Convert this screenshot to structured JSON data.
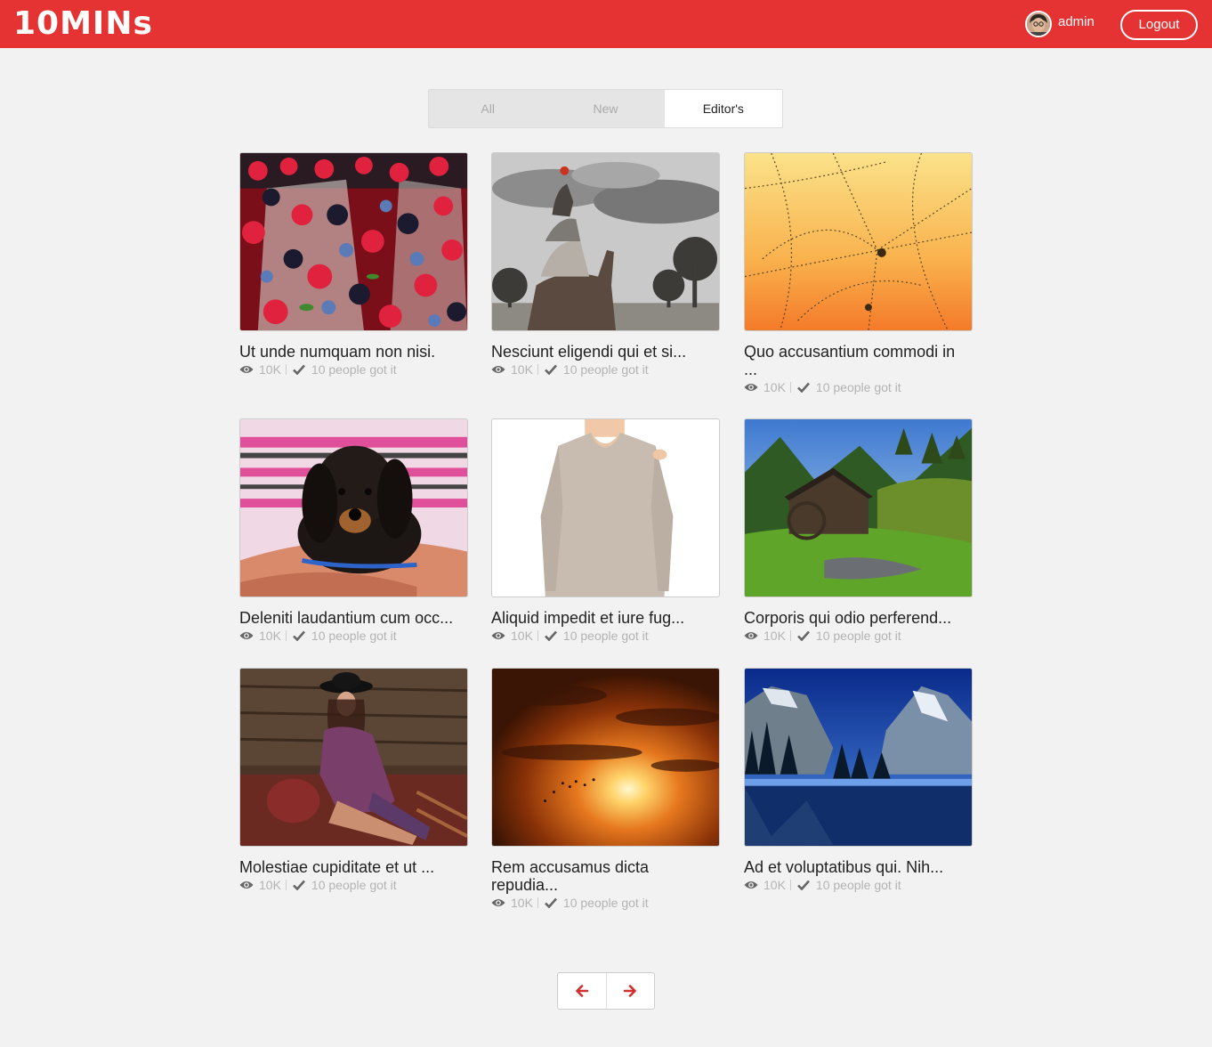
{
  "header": {
    "logo": "10MINs",
    "username": "admin",
    "logout_label": "Logout"
  },
  "tabs": [
    {
      "label": "All",
      "active": false
    },
    {
      "label": "New",
      "active": false
    },
    {
      "label": "Editor's",
      "active": true
    }
  ],
  "cards": [
    {
      "title": "Ut unde numquam non nisi.",
      "views": "10K",
      "got_it": "10 people got it",
      "image": "berries"
    },
    {
      "title": "Nesciunt eligendi qui et si...",
      "views": "10K",
      "got_it": "10 people got it",
      "image": "animal-stack"
    },
    {
      "title": "Quo accusantium commodi in ...",
      "views": "10K",
      "got_it": "10 people got it",
      "image": "dew-web"
    },
    {
      "title": "Deleniti laudantium cum occ...",
      "views": "10K",
      "got_it": "10 people got it",
      "image": "puppy"
    },
    {
      "title": "Aliquid impedit et iure fug...",
      "views": "10K",
      "got_it": "10 people got it",
      "image": "sweater"
    },
    {
      "title": "Corporis qui odio perferend...",
      "views": "10K",
      "got_it": "10 people got it",
      "image": "mill-forest"
    },
    {
      "title": "Molestiae cupiditate et ut ...",
      "views": "10K",
      "got_it": "10 people got it",
      "image": "fashion-model"
    },
    {
      "title": "Rem accusamus dicta repudia...",
      "views": "10K",
      "got_it": "10 people got it",
      "image": "sunset"
    },
    {
      "title": "Ad et voluptatibus qui. Nih...",
      "views": "10K",
      "got_it": "10 people got it",
      "image": "mountain-lake"
    }
  ],
  "pagination": {
    "prev_icon": "arrow-left-icon",
    "next_icon": "arrow-right-icon"
  },
  "colors": {
    "brand": "#e53333",
    "background": "#f2f2f2",
    "muted": "#b3b3b3"
  }
}
